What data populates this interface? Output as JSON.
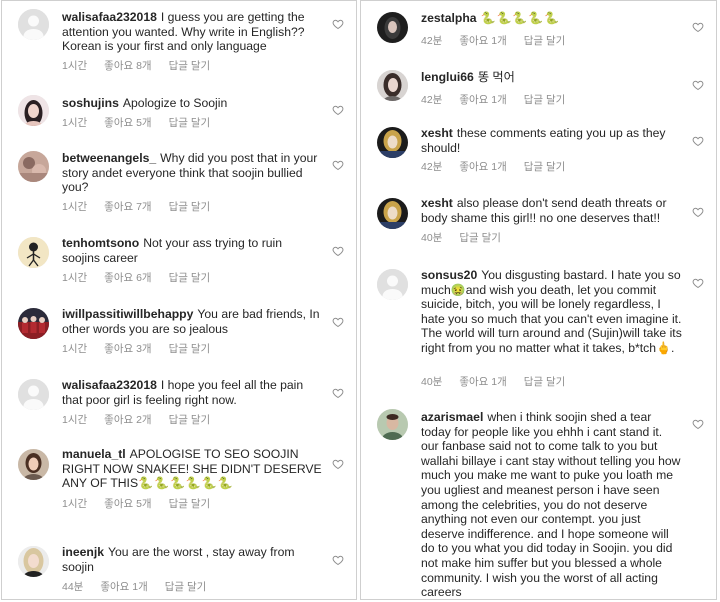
{
  "left_comments": [
    {
      "username": "walisafaa232018",
      "text": "I guess you are getting the attention you wanted. Why write in English?? Korean is your first and only language",
      "time": "1시간",
      "likes": "좋아요 8개",
      "reply": "답글 달기"
    },
    {
      "username": "soshujins",
      "text": "Apologize to Soojin",
      "time": "1시간",
      "likes": "좋아요 5개",
      "reply": "답글 달기"
    },
    {
      "username": "betweenangels_",
      "text": "Why did you post that in your story andet everyone think that soojin bullied you?",
      "time": "1시간",
      "likes": "좋아요 7개",
      "reply": "답글 달기"
    },
    {
      "username": "tenhomtsono",
      "text": "Not your ass trying to ruin soojins career",
      "time": "1시간",
      "likes": "좋아요 6개",
      "reply": "답글 달기"
    },
    {
      "username": "iwillpassitiwillbehappy",
      "text": "You are bad friends, In other words you are so jealous",
      "time": "1시간",
      "likes": "좋아요 3개",
      "reply": "답글 달기"
    },
    {
      "username": "walisafaa232018",
      "text": "I hope you feel all the pain that poor girl is feeling right now.",
      "time": "1시간",
      "likes": "좋아요 2개",
      "reply": "답글 달기"
    },
    {
      "username": "manuela_tl",
      "text": "APOLOGISE TO SEO SOOJIN RIGHT NOW SNAKEE! SHE DIDN'T DESERVE ANY OF THIS",
      "emoji": "🐍🐍🐍🐍🐍🐍",
      "time": "1시간",
      "likes": "좋아요 5개",
      "reply": "답글 달기"
    },
    {
      "username": "ineenjk",
      "text": "You are the worst , stay away from soojin",
      "time": "44분",
      "likes": "좋아요 1개",
      "reply": "답글 달기"
    }
  ],
  "right_comments": [
    {
      "username": "zestalpha",
      "text": "",
      "emoji": "🐍🐍🐍🐍🐍",
      "time": "42분",
      "likes": "좋아요 1개",
      "reply": "답글 달기"
    },
    {
      "username": "lenglui66",
      "text": "똥 먹어",
      "time": "42분",
      "likes": "좋아요 1개",
      "reply": "답글 달기"
    },
    {
      "username": "xesht",
      "text": "these comments eating you up as they should!",
      "time": "42분",
      "likes": "좋아요 1개",
      "reply": "답글 달기"
    },
    {
      "username": "xesht",
      "text": "also please don't send death threats or body shame this girl!! no one deserves that!!",
      "time": "40분",
      "likes": "",
      "reply": "답글 달기"
    },
    {
      "username": "sonsus20",
      "text_before": "You disgusting bastard.  I hate you so much",
      "emoji_mid": "🤢",
      "text_after": "and wish you death, let you commit suicide, bitch, you will be lonely regardless, I hate you so much that you can't even imagine it. The world will turn around and (Sujin)will take its right from you no matter what it takes, b*tch",
      "emoji_end": "🖕",
      "time": "40분",
      "likes": "좋아요 1개",
      "reply": "답글 달기"
    },
    {
      "username": "azarismael",
      "text": "when i think soojin shed a tear today for people like you ehhh i cant stand it. our fanbase said not to come talk to you but wallahi billaye i cant stay without telling you how much you make me want to puke you loath me you ugliest and meanest person i have seen among the celebrities, you do not deserve anything not even our contempt. you just deserve indifference. and I hope someone will do to you what you did today in Soojin. you did not make him suffer but you blessed a whole community. I wish you the worst of all acting careers",
      "time": "",
      "likes": "",
      "reply": ""
    }
  ]
}
